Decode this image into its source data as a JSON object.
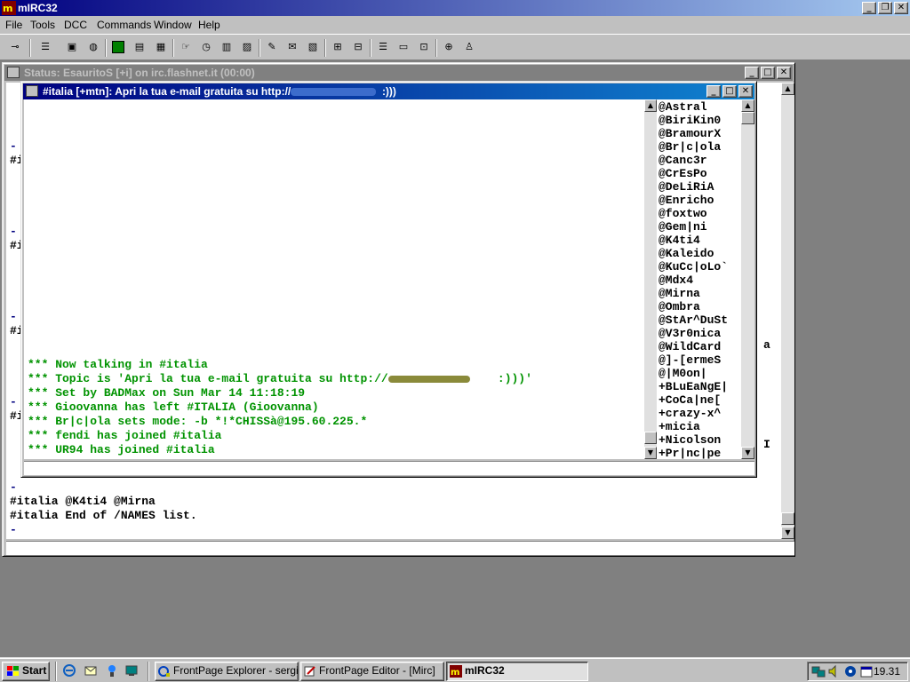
{
  "app": {
    "title": "mIRC32"
  },
  "menu": {
    "file": "File",
    "tools": "Tools",
    "dcc": "DCC",
    "commands": "Commands",
    "window": "Window",
    "help": "Help"
  },
  "status_window": {
    "title": "Status: EsauritoS [+i] on irc.flashnet.it (00:00)",
    "lines": [
      {
        "text": "-",
        "color": "#000080"
      },
      {
        "text": "#i",
        "color": "#000000"
      },
      {
        "text": "-",
        "color": "#000080"
      },
      {
        "text": "#i",
        "color": "#000000"
      },
      {
        "text": "-",
        "color": "#000080"
      },
      {
        "text": "#i",
        "color": "#000000"
      },
      {
        "text": "-",
        "color": "#000080"
      },
      {
        "text": "#i",
        "color": "#000000"
      },
      {
        "text": "-",
        "color": "#000080"
      },
      {
        "text": "#italia @K4ti4 @Mirna",
        "color": "#000000"
      },
      {
        "text": "#italia End of /NAMES list.",
        "color": "#000000"
      },
      {
        "text": "-",
        "color": "#000080"
      }
    ],
    "right_edge_chars": [
      "a",
      "I"
    ]
  },
  "channel_window": {
    "title_prefix": "#italia [+mtn]: Apri la tua e-mail gratuita su http://",
    "title_suffix": ":)))",
    "lines": [
      "*** Now talking in #italia",
      "*** Topic is 'Apri la tua e-mail gratuita su http://",
      "*** Set by BADMax on Sun Mar 14 11:18:19",
      "*** Gioovanna has left #ITALIA (Gioovanna)",
      "*** Br|c|ola sets mode: -b *!*CHISSà@195.60.225.*",
      "*** fendi has joined #italia",
      "*** UR94 has joined #italia"
    ],
    "topic_tail": ":)))'",
    "nicks": [
      "@Astral",
      "@BiriKin0",
      "@BramourX",
      "@Br|c|ola",
      "@Canc3r",
      "@CrEsPo",
      "@DeLiRiA",
      "@Enricho",
      "@foxtwo",
      "@Gem|ni",
      "@K4ti4",
      "@Kaleido",
      "@KuCc|oLo`",
      "@Mdx4",
      "@Mirna",
      "@Ombra",
      "@StAr^DuSt",
      "@V3r0nica",
      "@WildCard",
      "@]-[ermeS",
      "@|M0on|",
      "+BLuEaNgE|",
      "+CoCa|ne[",
      "+crazy-x^",
      "+micia",
      "+Nicolson",
      "+Pr|nc|pe"
    ]
  },
  "taskbar": {
    "start": "Start",
    "tasks": [
      {
        "label": "FrontPage Explorer - sergio...",
        "active": false
      },
      {
        "label": "FrontPage Editor - [Mirc]",
        "active": false
      },
      {
        "label": "mIRC32",
        "active": true
      }
    ],
    "clock": "19.31"
  },
  "colors": {
    "title_active": "#000080",
    "channel_text": "#009300",
    "status_text": "#000000"
  }
}
